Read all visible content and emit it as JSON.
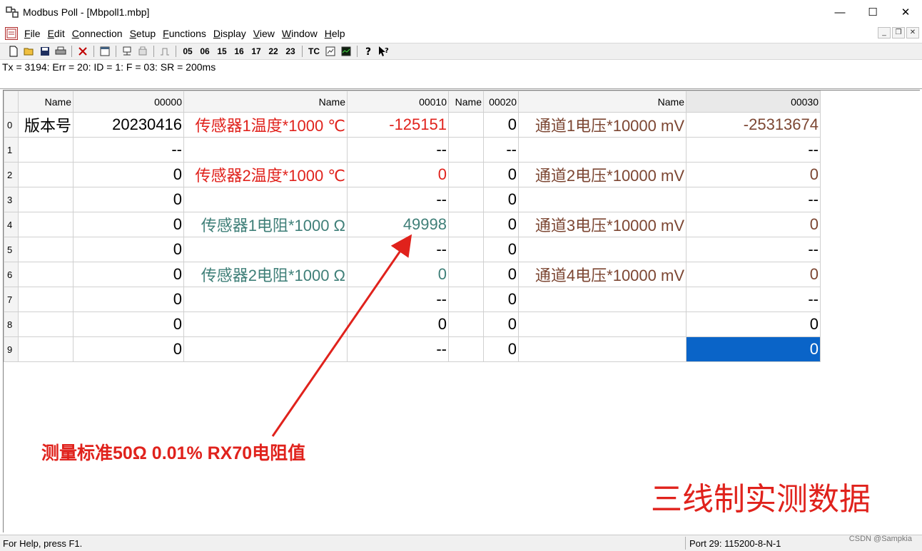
{
  "window": {
    "title": "Modbus Poll - [Mbpoll1.mbp]",
    "app_icon": "modbus-icon",
    "controls": {
      "minimize": "—",
      "maximize": "☐",
      "close": "✕"
    }
  },
  "menu": {
    "items": [
      {
        "key": "F",
        "rest": "ile"
      },
      {
        "key": "E",
        "rest": "dit"
      },
      {
        "key": "C",
        "rest": "onnection"
      },
      {
        "key": "S",
        "rest": "etup"
      },
      {
        "key": "F",
        "rest": "unctions"
      },
      {
        "key": "D",
        "rest": "isplay"
      },
      {
        "key": "V",
        "rest": "iew"
      },
      {
        "key": "W",
        "rest": "indow"
      },
      {
        "key": "H",
        "rest": "elp"
      }
    ],
    "mdi_controls": {
      "minimize": "_",
      "restore": "❐",
      "close": "✕"
    }
  },
  "toolbar": {
    "icons": [
      "new-icon",
      "open-icon",
      "save-icon",
      "print-icon",
      "delete-icon",
      "window-icon",
      "connect-icon",
      "disconnect-icon",
      "pulse-icon"
    ],
    "function_codes": [
      "05",
      "06",
      "15",
      "16",
      "17",
      "22",
      "23"
    ],
    "tc": "TC",
    "extra_icons": [
      "monitor-icon",
      "chart-icon",
      "help-icon",
      "context-help-icon"
    ]
  },
  "status": {
    "text": "Tx = 3194: Err = 20: ID = 1: F = 03: SR = 200ms"
  },
  "grid": {
    "headers": [
      "Name",
      "00000",
      "Name",
      "00010",
      "Name",
      "00020",
      "Name",
      "00030"
    ],
    "rows": [
      {
        "n": "0",
        "c": [
          "版本号",
          "20230416",
          "传感器1温度*1000 ℃",
          "-125151",
          "",
          "0",
          "通道1电压*10000 mV",
          "-25313674"
        ]
      },
      {
        "n": "1",
        "c": [
          "",
          "--",
          "",
          "--",
          "",
          "--",
          "",
          "--"
        ]
      },
      {
        "n": "2",
        "c": [
          "",
          "0",
          "传感器2温度*1000 ℃",
          "0",
          "",
          "0",
          "通道2电压*10000 mV",
          "0"
        ]
      },
      {
        "n": "3",
        "c": [
          "",
          "0",
          "",
          "--",
          "",
          "0",
          "",
          "--"
        ]
      },
      {
        "n": "4",
        "c": [
          "",
          "0",
          " 传感器1电阻*1000 Ω",
          "49998",
          "",
          "0",
          "通道3电压*10000 mV",
          "0"
        ]
      },
      {
        "n": "5",
        "c": [
          "",
          "0",
          "",
          "--",
          "",
          "0",
          "",
          "--"
        ]
      },
      {
        "n": "6",
        "c": [
          "",
          "0",
          " 传感器2电阻*1000 Ω",
          "0",
          "",
          "0",
          "通道4电压*10000 mV",
          "0"
        ]
      },
      {
        "n": "7",
        "c": [
          "",
          "0",
          "",
          "--",
          "",
          "0",
          "",
          "--"
        ]
      },
      {
        "n": "8",
        "c": [
          "",
          "0",
          "",
          "0",
          "",
          "0",
          "",
          "0"
        ]
      },
      {
        "n": "9",
        "c": [
          "",
          "0",
          "",
          "--",
          "",
          "0",
          "",
          "0"
        ]
      }
    ]
  },
  "annotations": {
    "measure": "测量标准50Ω 0.01% RX70电阻值",
    "three_wire": "三线制实测数据"
  },
  "footer": {
    "help": "For Help, press F1.",
    "port": "Port 29: 115200-8-N-1",
    "watermark": "CSDN @Sampkia"
  },
  "colors": {
    "red": "#e0221c",
    "teal": "#3f7f78",
    "brown": "#7c4632",
    "selection": "#0a64c8"
  }
}
